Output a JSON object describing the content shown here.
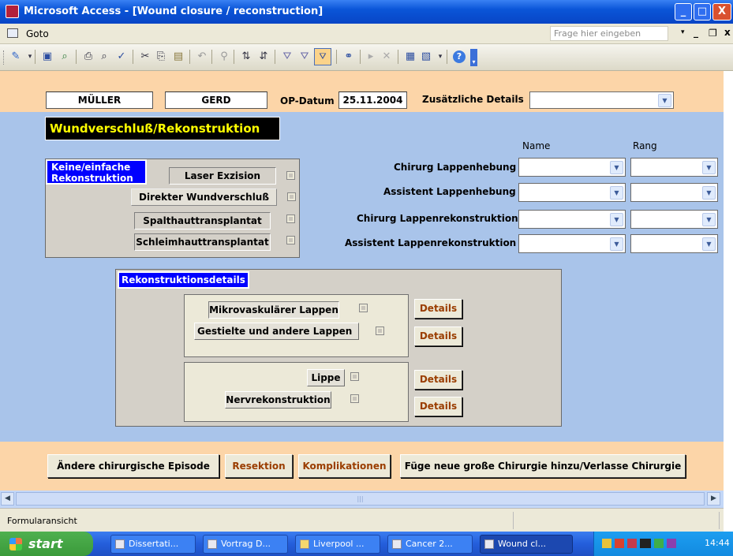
{
  "window": {
    "title": "Microsoft Access - [Wound closure / reconstruction]",
    "minimize": "_",
    "maximize": "□",
    "close": "X"
  },
  "menubar": {
    "goto": "Goto",
    "help_placeholder": "Frage hier eingeben",
    "doc_min": "_",
    "doc_restore": "❐",
    "doc_close": "x"
  },
  "header": {
    "surname": "MÜLLER",
    "firstname": "GERD",
    "op_date_label": "OP-Datum",
    "op_date": "25.11.2004",
    "details_label": "Zusätzliche Details",
    "details_value": ""
  },
  "section_title": "Wundverschluß/Rekonstruktion",
  "simple": {
    "tag_line1": "Keine/einfache",
    "tag_line2": "Rekonstruktion",
    "options": [
      "Laser Exzision",
      "Direkter Wundverschluß",
      "Spalthauttransplantat",
      "Schleimhauttransplantat"
    ]
  },
  "team": {
    "col_name": "Name",
    "col_rang": "Rang",
    "rows": [
      "Chirurg Lappenhebung",
      "Assistent Lappenhebung",
      "Chirurg Lappenrekonstruktion",
      "Assistent Lappenrekonstruktion"
    ]
  },
  "recon": {
    "tag": "Rekonstruktionsdetails",
    "mikro": "Mikrovaskulärer Lappen",
    "gestielte": "Gestielte und andere Lappen",
    "lippe": "Lippe",
    "nerv": "Nervrekonstruktion",
    "details": "Details"
  },
  "footer": {
    "andere": "Ändere chirurgische Episode",
    "resektion": "Resektion",
    "komplikationen": "Komplikationen",
    "fuege": "Füge neue große Chirurgie hinzu/Verlasse Chirurgie"
  },
  "status": "Formularansicht",
  "taskbar": {
    "start": "start",
    "tasks": [
      "Dissertati...",
      "Vortrag D...",
      "Liverpool ...",
      "Cancer 2...",
      "Wound cl..."
    ],
    "clock": "14:44"
  },
  "colors": {
    "title_blue": "#0a55d8",
    "form_blue": "#a9c4ea",
    "band_orange": "#fcd5a8",
    "tag_blue": "#0000ff",
    "heading_yellow": "#ffff00",
    "button_text_brown": "#9a3d00"
  }
}
